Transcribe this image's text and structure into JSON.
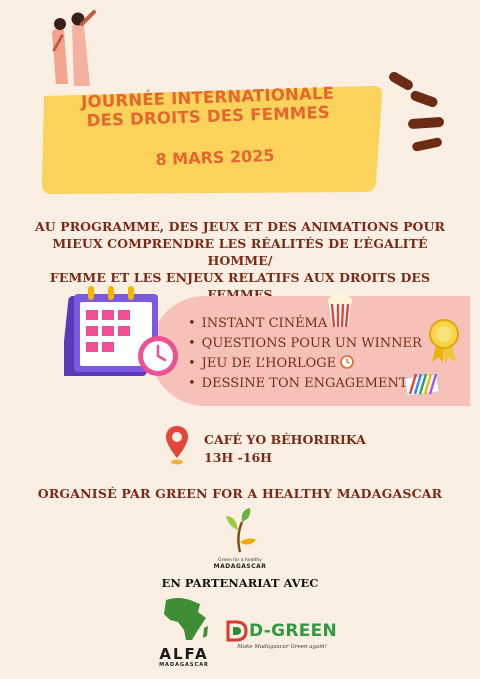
{
  "title": {
    "line1": "JOURNÉE INTERNATIONALE",
    "line2": "DES DROITS DES FEMMES",
    "date": "8 MARS 2025"
  },
  "program": {
    "line1": "AU PROGRAMME, DES JEUX ET DES ANIMATIONS POUR",
    "line2": "MIEUX COMPRENDRE LES RÉALITÉS DE L’ÉGALITÉ HOMME/",
    "line3": "FEMME ET LES ENJEUX RELATIFS AUX DROITS DES FEMMES"
  },
  "activities": [
    "INSTANT CINÉMA",
    "QUESTIONS POUR UN  WINNER",
    "JEU DE L’HORLOGE",
    "DESSINE TON ENGAGEMENT"
  ],
  "location": {
    "venue": "CAFÉ YO BÉHORIRIKA",
    "hours": "13H -16H"
  },
  "organizer": "ORGANISÉ PAR GREEN FOR A HEALTHY MADAGASCAR",
  "logo_green": {
    "tagline": "Green for a healthy",
    "name": "MADAGASCAR"
  },
  "partner_label": "EN PARTENARIAT AVEC",
  "logo_alfa": {
    "name": "ALFA",
    "sub": "MADAGASCAR"
  },
  "logo_dgreen": {
    "name": "D-GREEN",
    "tagline": "Make Madagascar Green again!"
  },
  "colors": {
    "background": "#fbefe4",
    "banner": "#fbd25a",
    "accent_orange": "#e3672f",
    "text_brown": "#7a2a16",
    "pill_pink": "#f6c1b9",
    "calendar_purple": "#6a49c8",
    "location_red": "#e2473a"
  }
}
